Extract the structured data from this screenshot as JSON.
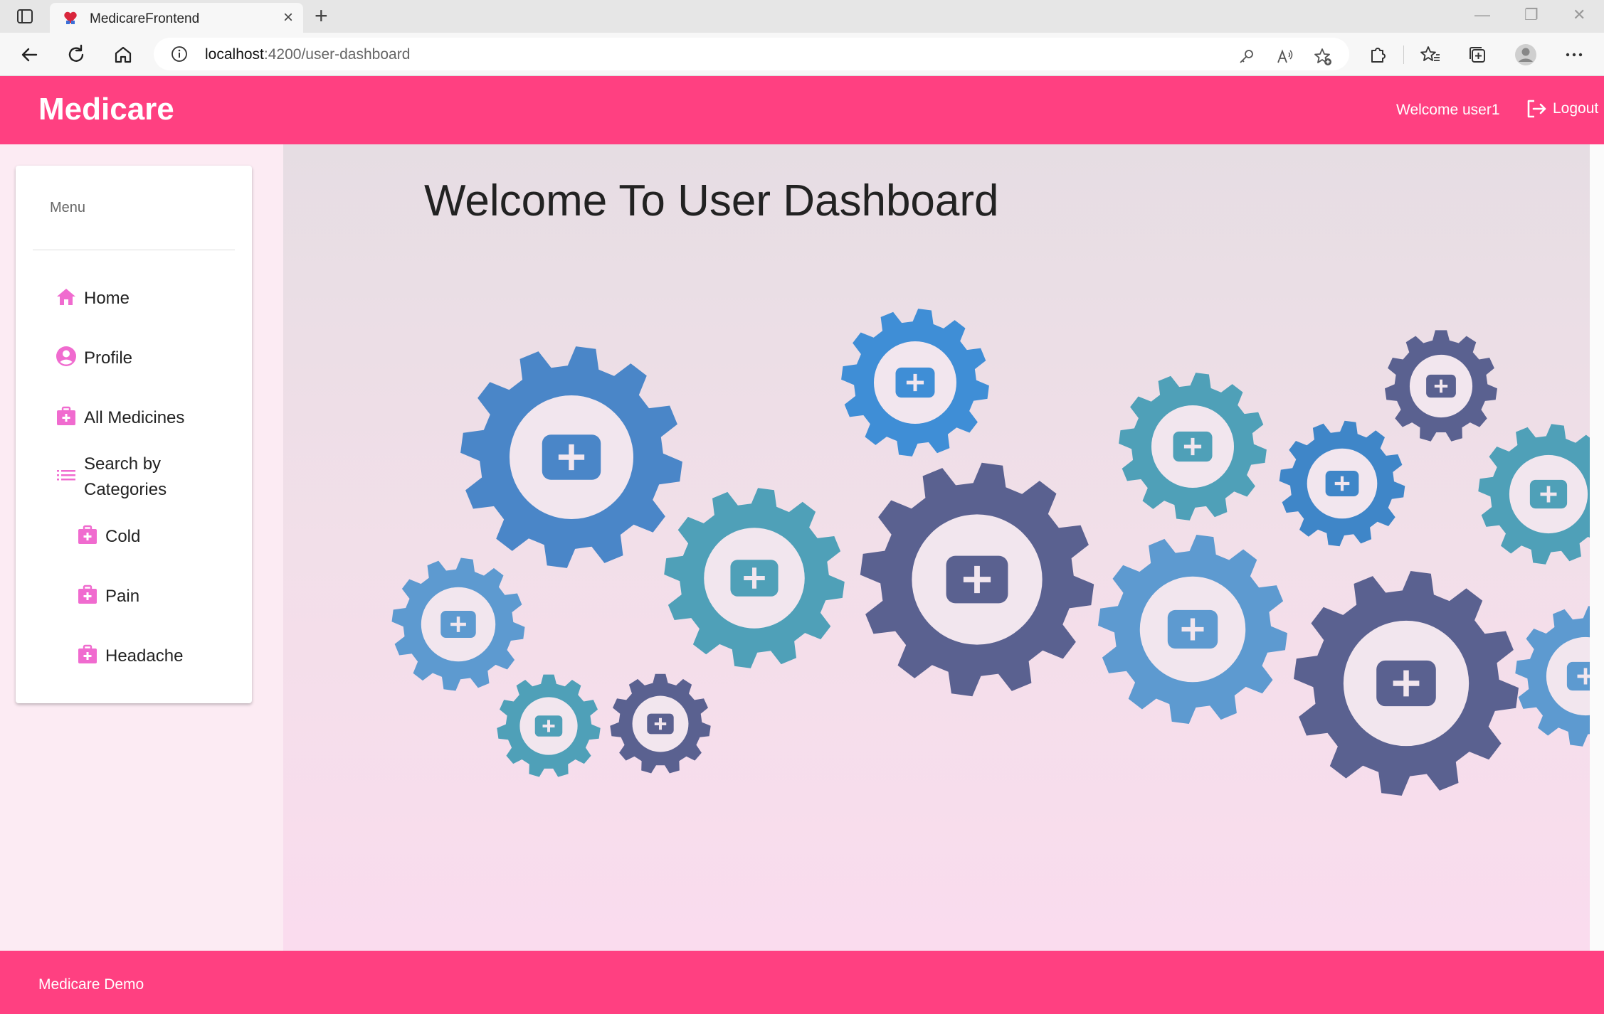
{
  "browser": {
    "tab_title": "MedicareFrontend",
    "url_host": "localhost",
    "url_path": ":4200/user-dashboard"
  },
  "header": {
    "brand": "Medicare",
    "welcome": "Welcome user1",
    "logout_label": "Logout"
  },
  "sidebar": {
    "menu_title": "Menu",
    "items": [
      {
        "label": "Home",
        "icon": "home-icon"
      },
      {
        "label": "Profile",
        "icon": "account-circle-icon"
      },
      {
        "label": "All Medicines",
        "icon": "medical-bag-icon"
      },
      {
        "label": "Search by Categories",
        "icon": "list-icon"
      },
      {
        "label": "Cold",
        "icon": "medical-bag-icon"
      },
      {
        "label": "Pain",
        "icon": "medical-bag-icon"
      },
      {
        "label": "Headache",
        "icon": "medical-bag-icon"
      }
    ]
  },
  "main": {
    "title": "Welcome To User Dashboard",
    "illustration": "medical gears illustration"
  },
  "footer": {
    "text": "Medicare Demo"
  },
  "colors": {
    "brand_pink": "#ff4081",
    "icon_pink": "#f06bcf",
    "gear_blue": "#4a86c8",
    "gear_teal": "#4fa0b8",
    "gear_navy": "#5a6190",
    "gear_light_blue": "#5d9ad0"
  }
}
